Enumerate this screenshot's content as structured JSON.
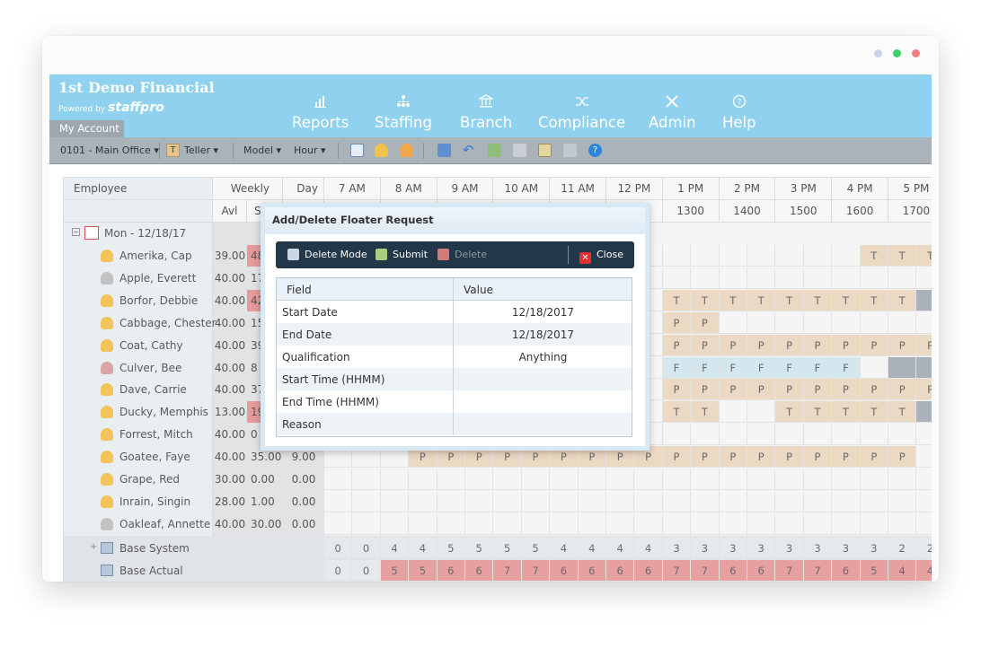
{
  "window": {
    "dot_colors": [
      "#c9d3e8",
      "#3fcf6d",
      "#f27f7f"
    ]
  },
  "header": {
    "title": "1st Demo Financial",
    "powered_by": "Powered by",
    "powered_brand": "staffpro",
    "my_account": "My Account",
    "nav": [
      {
        "label": "Reports",
        "icon": "bar-chart-icon"
      },
      {
        "label": "Staffing",
        "icon": "org-chart-icon"
      },
      {
        "label": "Branch",
        "icon": "bank-icon"
      },
      {
        "label": "Compliance",
        "icon": "shuffle-icon"
      },
      {
        "label": "Admin",
        "icon": "tools-icon"
      },
      {
        "label": "Help",
        "icon": "question-icon"
      }
    ]
  },
  "toolbar": {
    "location": "0101 - Main Office",
    "role_badge": "T",
    "role": "Teller",
    "model": "Model",
    "hour": "Hour"
  },
  "grid": {
    "header_row1": {
      "employee": "Employee",
      "weekly": "Weekly",
      "day": "Day",
      "hours": [
        "7 AM",
        "8 AM",
        "9 AM",
        "10 AM",
        "11 AM",
        "12 PM",
        "1 PM",
        "2 PM",
        "3 PM",
        "4 PM",
        "5 PM"
      ]
    },
    "header_row2": {
      "avl": "Avl",
      "sched": "S",
      "times": [
        "1300",
        "1400",
        "1500",
        "1600",
        "1700"
      ]
    },
    "date_row": "Mon - 12/18/17",
    "employees": [
      {
        "name": "Amerika, Cap",
        "avl": "39.00",
        "s": "48",
        "day": "",
        "red": true
      },
      {
        "name": "Apple, Everett",
        "avl": "40.00",
        "s": "17",
        "day": "",
        "red": false
      },
      {
        "name": "Borfor, Debbie",
        "avl": "40.00",
        "s": "42",
        "day": "",
        "red": true
      },
      {
        "name": "Cabbage, Chester",
        "avl": "40.00",
        "s": "15",
        "day": "",
        "red": false
      },
      {
        "name": "Coat, Cathy",
        "avl": "40.00",
        "s": "39",
        "day": "",
        "red": false
      },
      {
        "name": "Culver, Bee",
        "avl": "40.00",
        "s": "8",
        "day": "",
        "red": false
      },
      {
        "name": "Dave, Carrie",
        "avl": "40.00",
        "s": "37",
        "day": "",
        "red": false
      },
      {
        "name": "Ducky, Memphis",
        "avl": "13.00",
        "s": "19",
        "day": "",
        "red": true
      },
      {
        "name": "Forrest, Mitch",
        "avl": "40.00",
        "s": "0",
        "day": "",
        "red": false
      },
      {
        "name": "Goatee, Faye",
        "avl": "40.00",
        "s": "35.00",
        "day": "9.00",
        "red": false
      },
      {
        "name": "Grape, Red",
        "avl": "30.00",
        "s": "0.00",
        "day": "0.00",
        "red": false
      },
      {
        "name": "Inrain, Singin",
        "avl": "28.00",
        "s": "1.00",
        "day": "0.00",
        "red": false
      },
      {
        "name": "Oakleaf, Annette",
        "avl": "40.00",
        "s": "30.00",
        "day": "0.00",
        "red": false
      }
    ],
    "base_system": {
      "label": "Base System",
      "values": [
        "0",
        "0",
        "4",
        "4",
        "5",
        "5",
        "5",
        "5",
        "4",
        "4",
        "4",
        "4",
        "3",
        "3",
        "3",
        "3",
        "3",
        "3",
        "3",
        "3",
        "2",
        "2"
      ]
    },
    "base_actual": {
      "label": "Base Actual",
      "values": [
        "0",
        "0",
        "5",
        "5",
        "6",
        "6",
        "7",
        "7",
        "6",
        "6",
        "6",
        "6",
        "7",
        "7",
        "6",
        "6",
        "7",
        "7",
        "6",
        "5",
        "4",
        "4"
      ]
    }
  },
  "dialog": {
    "title": "Add/Delete Floater Request",
    "buttons": {
      "delete_mode": "Delete Mode",
      "submit": "Submit",
      "delete": "Delete",
      "close": "Close"
    },
    "col_field": "Field",
    "col_value": "Value",
    "rows": [
      {
        "field": "Start Date",
        "value": "12/18/2017"
      },
      {
        "field": "End Date",
        "value": "12/18/2017"
      },
      {
        "field": "Qualification",
        "value": "Anything"
      },
      {
        "field": "Start Time (HHMM)",
        "value": ""
      },
      {
        "field": "End Time (HHMM)",
        "value": ""
      },
      {
        "field": "Reason",
        "value": ""
      }
    ]
  }
}
